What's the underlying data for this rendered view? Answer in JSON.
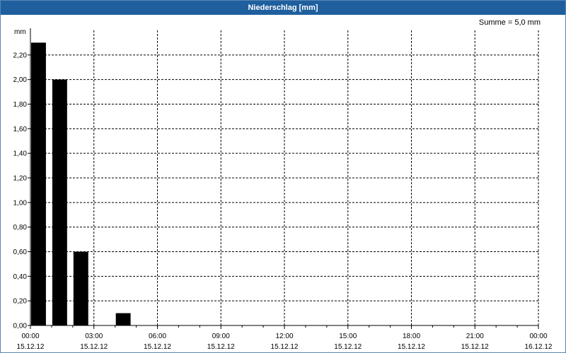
{
  "window": {
    "title": "Niederschlag [mm]"
  },
  "summary": "Summe = 5,0 mm",
  "chart_data": {
    "type": "bar",
    "title": "Niederschlag [mm]",
    "ylabel": "mm",
    "ylim": [
      0,
      2.4
    ],
    "ytick_values": [
      0,
      0.2,
      0.4,
      0.6,
      0.8,
      1.0,
      1.2,
      1.4,
      1.6,
      1.8,
      2.0,
      2.2
    ],
    "ytick_labels": [
      "0,00",
      "0,20",
      "0,40",
      "0,60",
      "0,80",
      "1,00",
      "1,20",
      "1,40",
      "1,60",
      "1,80",
      "2,00",
      "2,20"
    ],
    "xlim_hours": [
      0,
      24
    ],
    "xticks": [
      {
        "time": "00:00",
        "date": "15.12.12"
      },
      {
        "time": "03:00",
        "date": "15.12.12"
      },
      {
        "time": "06:00",
        "date": "15.12.12"
      },
      {
        "time": "09:00",
        "date": "15.12.12"
      },
      {
        "time": "12:00",
        "date": "15.12.12"
      },
      {
        "time": "15:00",
        "date": "15.12.12"
      },
      {
        "time": "18:00",
        "date": "15.12.12"
      },
      {
        "time": "21:00",
        "date": "15.12.12"
      },
      {
        "time": "00:00",
        "date": "16.12.12"
      }
    ],
    "bars": [
      {
        "start": "00:00",
        "end": "01:00",
        "value": 2.3
      },
      {
        "start": "01:00",
        "end": "02:00",
        "value": 2.0
      },
      {
        "start": "02:00",
        "end": "03:00",
        "value": 0.6
      },
      {
        "start": "04:00",
        "end": "05:00",
        "value": 0.1
      }
    ],
    "grid": true,
    "bar_color": "#000000"
  }
}
